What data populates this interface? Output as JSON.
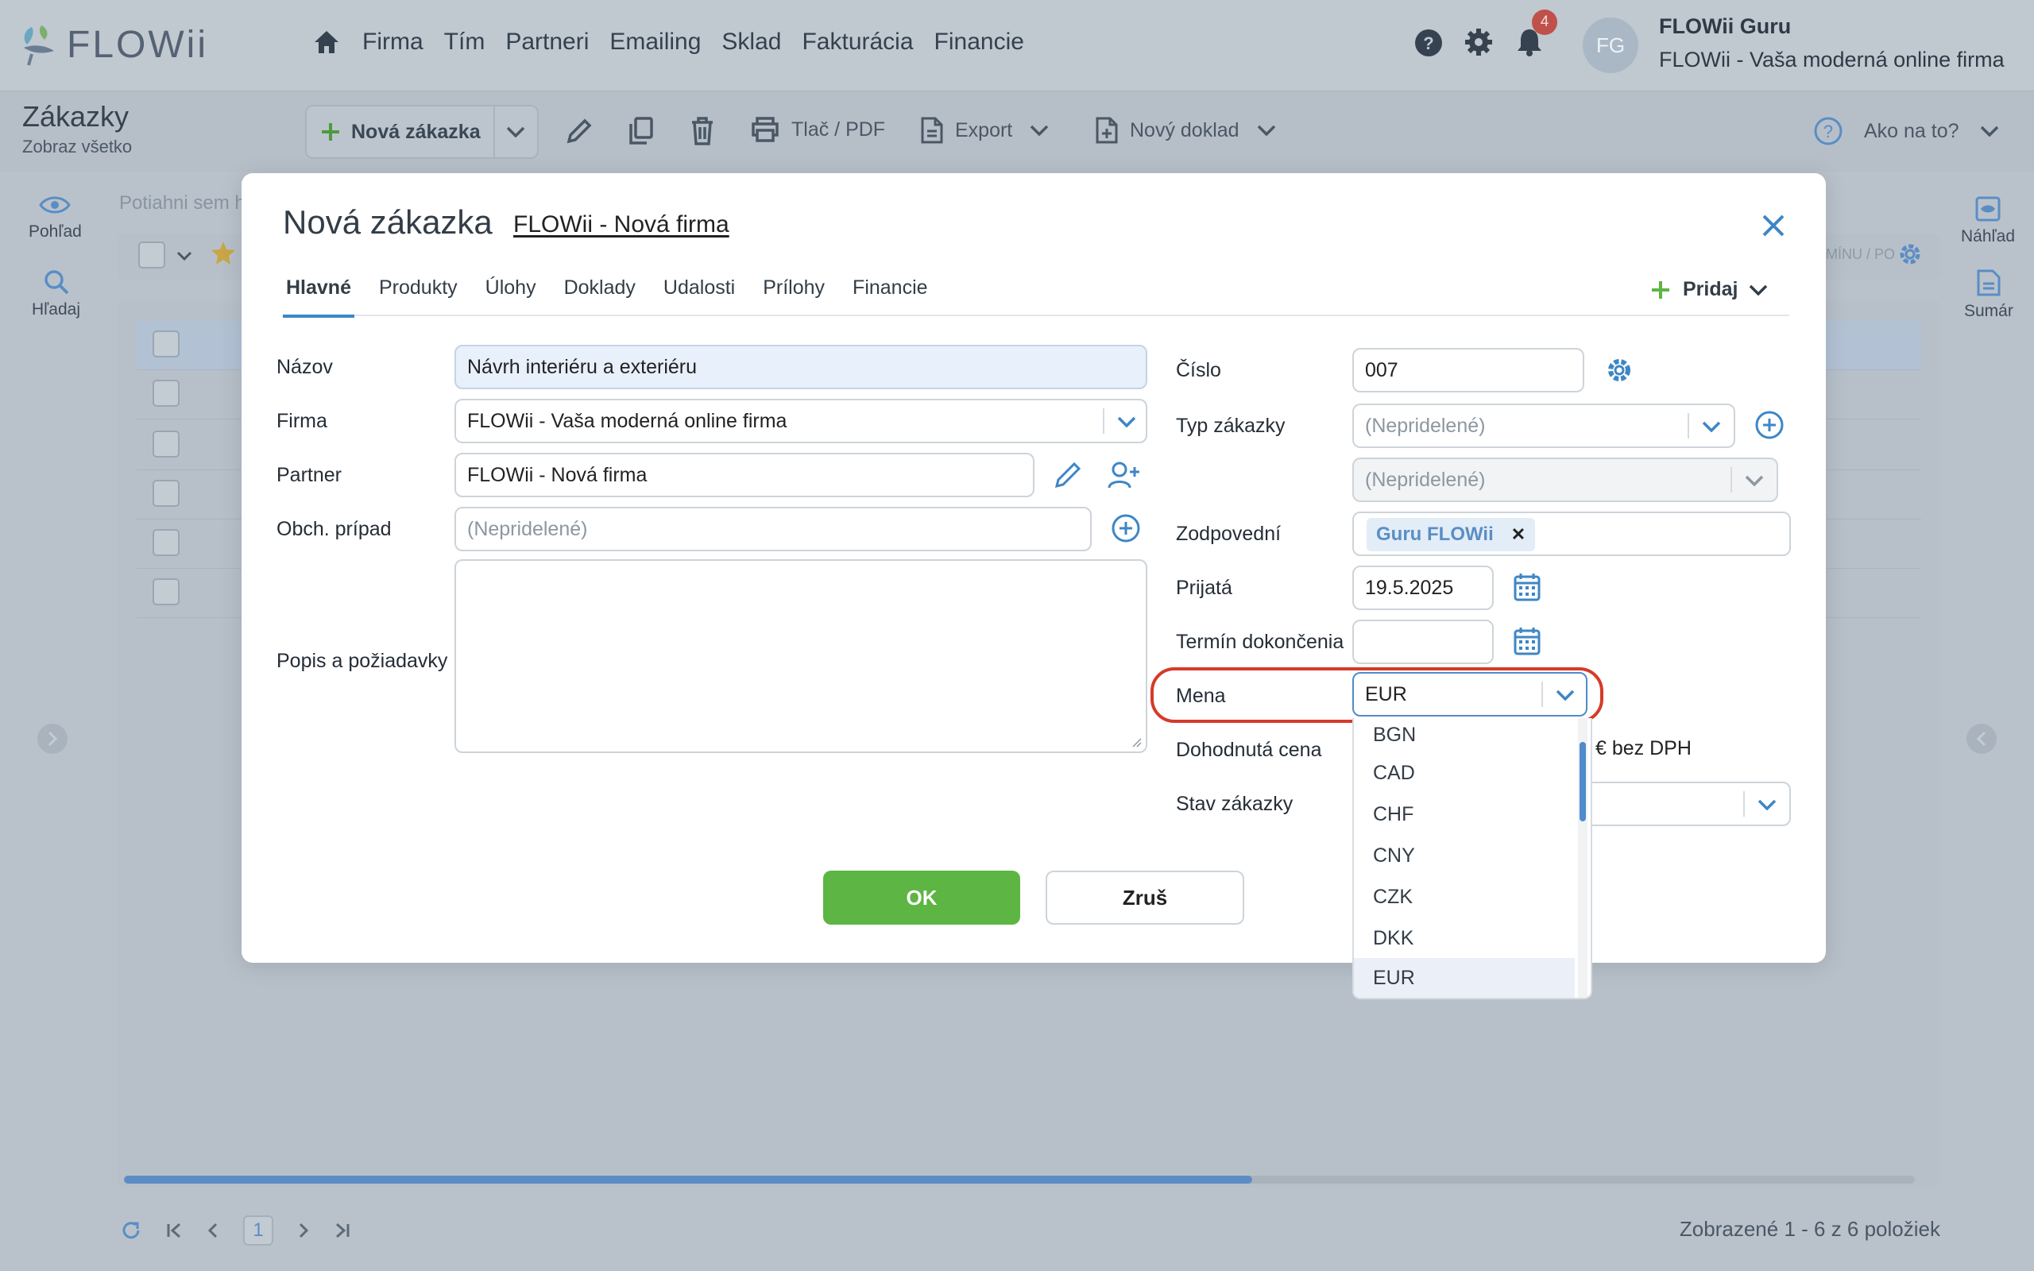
{
  "app": {
    "logo_text": "FLOWii"
  },
  "nav": {
    "items": [
      "Firma",
      "Tím",
      "Partneri",
      "Emailing",
      "Sklad",
      "Fakturácia",
      "Financie"
    ]
  },
  "header": {
    "notifications_count": "4",
    "avatar_initials": "FG",
    "user_name": "FLOWii Guru",
    "user_company": "FLOWii - Vaša moderná online firma"
  },
  "page": {
    "title": "Zákazky",
    "subtitle": "Zobraz všetko"
  },
  "toolbar": {
    "new_label": "Nová zákazka",
    "print_label": "Tlač / PDF",
    "export_label": "Export",
    "new_doc_label": "Nový doklad",
    "help_label": "Ako na to?"
  },
  "sidebar_left": {
    "view_label": "Pohľad",
    "search_label": "Hľadaj"
  },
  "sidebar_right": {
    "preview_label": "Náhľad",
    "summary_label": "Sumár"
  },
  "background": {
    "drag_hint": "Potiahni sem h",
    "menu_hint": "MÍNU / PO"
  },
  "pager": {
    "current_page": "1",
    "info": "Zobrazené 1 - 6 z 6 položiek"
  },
  "modal": {
    "title": "Nová zákazka",
    "partner_link": "FLOWii - Nová firma",
    "tabs": [
      "Hlavné",
      "Produkty",
      "Úlohy",
      "Doklady",
      "Udalosti",
      "Prílohy",
      "Financie"
    ],
    "active_tab": "Hlavné",
    "add_label": "Pridaj",
    "left": {
      "nazov_label": "Názov",
      "nazov_value": "Návrh interiéru a exteriéru",
      "firma_label": "Firma",
      "firma_value": "FLOWii - Vaša moderná online firma",
      "partner_label": "Partner",
      "partner_value": "FLOWii - Nová firma",
      "obch_label": "Obch. prípad",
      "obch_placeholder": "(Nepridelené)",
      "popis_label": "Popis a požiadavky"
    },
    "right": {
      "cislo_label": "Číslo",
      "cislo_value": "007",
      "typ_label": "Typ zákazky",
      "typ_placeholder": "(Nepridelené)",
      "subtyp_placeholder": "(Nepridelené)",
      "zodp_label": "Zodpovední",
      "zodp_tag": "Guru FLOWii",
      "prijata_label": "Prijatá",
      "prijata_value": "19.5.2025",
      "termin_label": "Termín dokončenia",
      "termin_value": "",
      "mena_label": "Mena",
      "mena_value": "EUR",
      "cena_label": "Dohodnutá cena",
      "cena_suffix": "€ bez DPH",
      "stav_label": "Stav zákazky"
    },
    "ok_label": "OK",
    "cancel_label": "Zruš"
  },
  "currency_dropdown": {
    "options": [
      "BGN",
      "CAD",
      "CHF",
      "CNY",
      "CZK",
      "DKK",
      "EUR"
    ],
    "selected": "EUR"
  },
  "colors": {
    "accent": "#3d86c6",
    "ok_green": "#5db543",
    "highlight_red": "#d63a2a",
    "badge_red": "#c0504a"
  }
}
